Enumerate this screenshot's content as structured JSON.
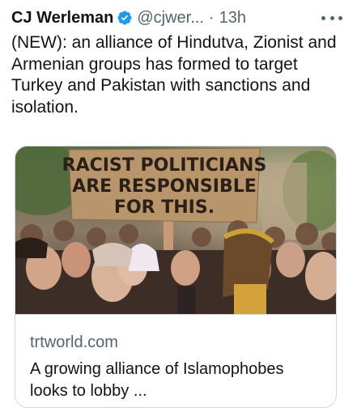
{
  "tweet": {
    "author_name": "CJ Werleman",
    "handle": "@cjwer...",
    "separator": "·",
    "time": "13h",
    "text": "(NEW): an alliance of Hindutva, Zionist and Armenian groups has formed to target Turkey and Pakistan with sanctions and isolation."
  },
  "card": {
    "sign_line1": "RACIST POLITICIANS",
    "sign_line2": "ARE RESPONSIBLE",
    "sign_line3": "FOR THIS.",
    "domain": "trtworld.com",
    "title": "A growing alliance of Islamophobes looks to lobby ..."
  },
  "icons": {
    "verified": "verified-badge-icon",
    "more": "more-horizontal-icon"
  },
  "colors": {
    "verified_blue": "#1d9bf0",
    "secondary_text": "#536471",
    "border": "#cfd9de"
  }
}
